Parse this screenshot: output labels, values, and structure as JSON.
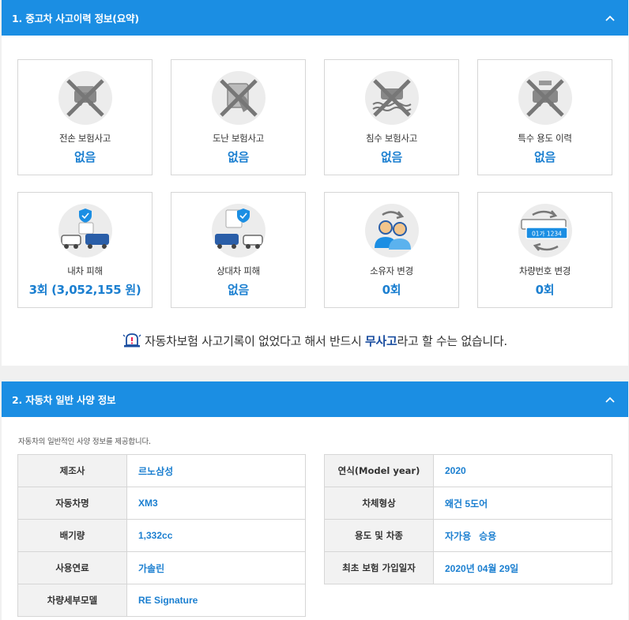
{
  "section1": {
    "title": "1. 중고차 사고이력 정보(요약)",
    "cards": [
      {
        "label": "전손 보험사고",
        "value": "없음",
        "icon": "total-loss-icon"
      },
      {
        "label": "도난 보험사고",
        "value": "없음",
        "icon": "theft-icon"
      },
      {
        "label": "침수 보험사고",
        "value": "없음",
        "icon": "flood-icon"
      },
      {
        "label": "특수 용도 이력",
        "value": "없음",
        "icon": "taxi-icon"
      },
      {
        "label": "내차 피해",
        "value": "3회 (3,052,155 원)",
        "icon": "my-car-damage-icon"
      },
      {
        "label": "상대차 피해",
        "value": "없음",
        "icon": "other-car-damage-icon"
      },
      {
        "label": "소유자 변경",
        "value": "0회",
        "icon": "owner-change-icon"
      },
      {
        "label": "차량번호 변경",
        "value": "0회",
        "icon": "plate-change-icon"
      }
    ],
    "plate_text": "01가 1234",
    "notice_pre": "자동차보험 사고기록이 없었다고 해서 반드시 ",
    "notice_highlight": "무사고",
    "notice_post": "라고 할 수는 없습니다."
  },
  "section2": {
    "title": "2. 자동차 일반 사양 정보",
    "description": "자동차의 일반적인 사양 정보를 제공합니다.",
    "left_table": [
      {
        "label": "제조사",
        "value": "르노삼성"
      },
      {
        "label": "자동차명",
        "value": "XM3"
      },
      {
        "label": "배기량",
        "value": "1,332cc"
      },
      {
        "label": "사용연료",
        "value": "가솔린"
      },
      {
        "label": "차량세부모델",
        "value": "RE Signature"
      }
    ],
    "right_table": [
      {
        "label": "연식(Model year)",
        "value": "2020"
      },
      {
        "label": "차체형상",
        "value": "왜건 5도어"
      },
      {
        "label": "용도 및 차종",
        "value": "자가용   승용"
      },
      {
        "label": "최초 보험 가입일자",
        "value": "2020년 04월 29일"
      }
    ]
  },
  "colors": {
    "header_bg": "#1b8ee3",
    "value_blue": "#1b7fd0",
    "highlight": "#1b4ea0"
  }
}
